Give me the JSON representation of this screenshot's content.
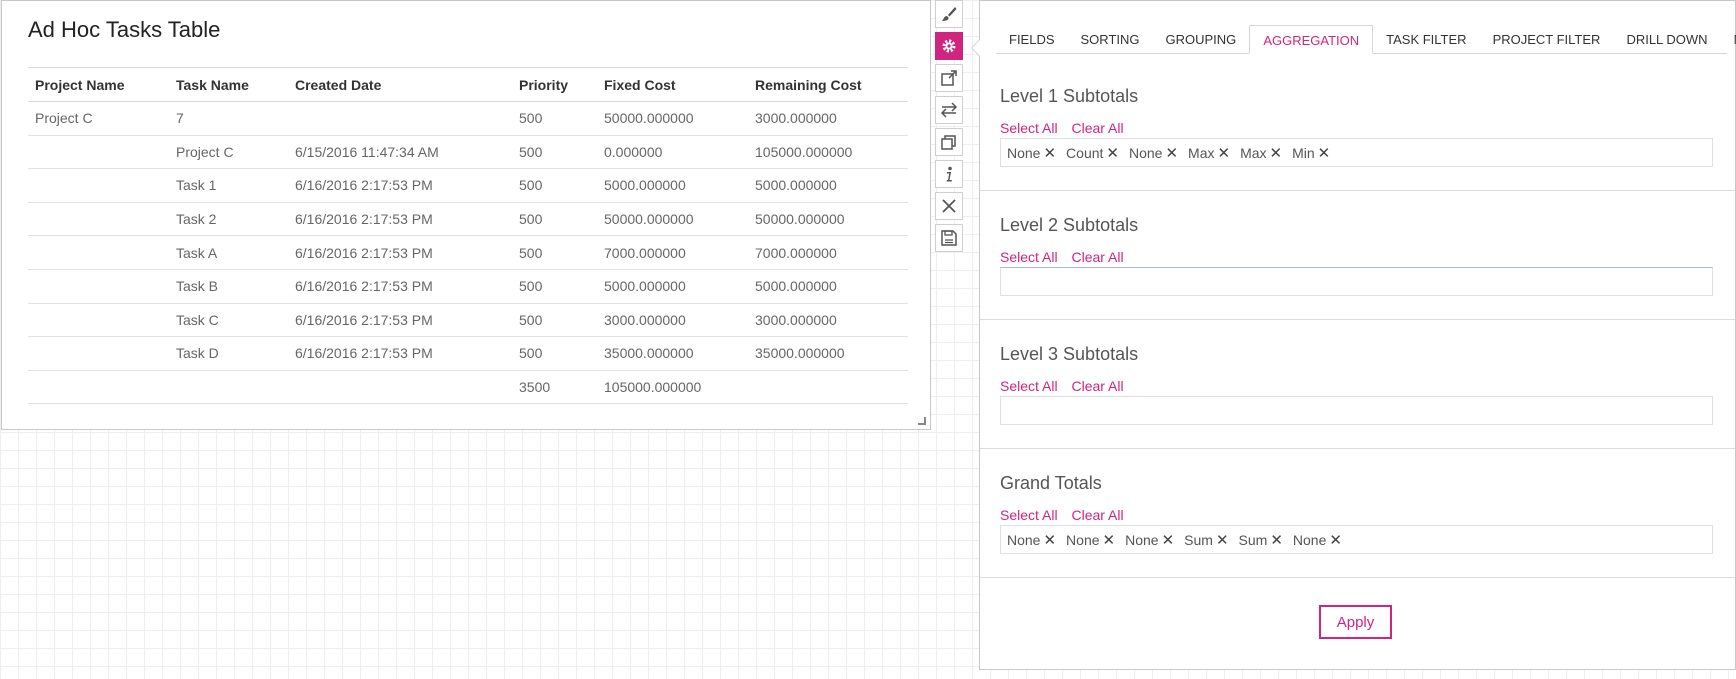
{
  "table_panel": {
    "title": "Ad Hoc Tasks Table",
    "columns": [
      "Project Name",
      "Task Name",
      "Created Date",
      "Priority",
      "Fixed Cost",
      "Remaining Cost"
    ],
    "rows": [
      [
        "Project C",
        "7",
        "",
        "500",
        "50000.000000",
        "3000.000000"
      ],
      [
        "",
        "Project C",
        "6/15/2016 11:47:34 AM",
        "500",
        "0.000000",
        "105000.000000"
      ],
      [
        "",
        "Task 1",
        "6/16/2016 2:17:53 PM",
        "500",
        "5000.000000",
        "5000.000000"
      ],
      [
        "",
        "Task 2",
        "6/16/2016 2:17:53 PM",
        "500",
        "50000.000000",
        "50000.000000"
      ],
      [
        "",
        "Task A",
        "6/16/2016 2:17:53 PM",
        "500",
        "7000.000000",
        "7000.000000"
      ],
      [
        "",
        "Task B",
        "6/16/2016 2:17:53 PM",
        "500",
        "5000.000000",
        "5000.000000"
      ],
      [
        "",
        "Task C",
        "6/16/2016 2:17:53 PM",
        "500",
        "3000.000000",
        "3000.000000"
      ],
      [
        "",
        "Task D",
        "6/16/2016 2:17:53 PM",
        "500",
        "35000.000000",
        "35000.000000"
      ],
      [
        "",
        "",
        "",
        "3500",
        "105000.000000",
        ""
      ]
    ]
  },
  "toolbar": {
    "buttons": [
      {
        "icon": "brush-icon",
        "active": false
      },
      {
        "icon": "gear-icon",
        "active": true
      },
      {
        "icon": "external-link-icon",
        "active": false
      },
      {
        "icon": "swap-arrows-icon",
        "active": false
      },
      {
        "icon": "duplicate-icon",
        "active": false
      },
      {
        "icon": "info-icon",
        "active": false
      },
      {
        "icon": "close-icon",
        "active": false
      },
      {
        "icon": "save-icon",
        "active": false
      }
    ],
    "accent_color": "#d0257f"
  },
  "settings": {
    "tabs": [
      {
        "label": "FIELDS",
        "active": false
      },
      {
        "label": "SORTING",
        "active": false
      },
      {
        "label": "GROUPING",
        "active": false
      },
      {
        "label": "AGGREGATION",
        "active": true
      },
      {
        "label": "TASK FILTER",
        "active": false
      },
      {
        "label": "PROJECT FILTER",
        "active": false
      },
      {
        "label": "DRILL DOWN",
        "active": false
      },
      {
        "label": "MISC",
        "active": false
      }
    ],
    "select_all_label": "Select All",
    "clear_all_label": "Clear All",
    "sections": [
      {
        "title": "Level 1 Subtotals",
        "chips": [
          "None",
          "Count",
          "None",
          "Max",
          "Max",
          "Min"
        ]
      },
      {
        "title": "Level 2 Subtotals",
        "chips": []
      },
      {
        "title": "Level 3 Subtotals",
        "chips": []
      },
      {
        "title": "Grand Totals",
        "chips": [
          "None",
          "None",
          "None",
          "Sum",
          "Sum",
          "None"
        ]
      }
    ],
    "apply_label": "Apply"
  }
}
